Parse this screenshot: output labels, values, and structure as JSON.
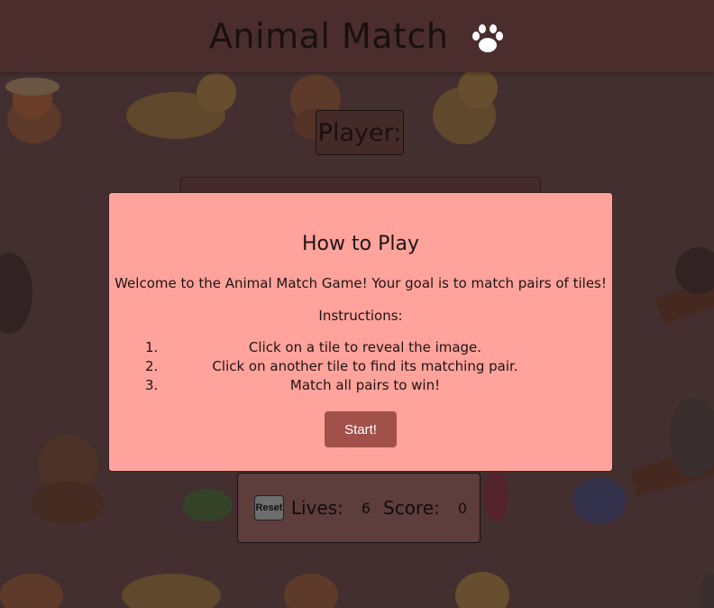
{
  "header": {
    "title": "Animal Match",
    "logo_icon": "paw-icon"
  },
  "player": {
    "label": "Player:"
  },
  "modal": {
    "title": "How to Play",
    "welcome": "Welcome to the Animal Match Game! Your goal is to match pairs of tiles!",
    "instructions_title": "Instructions:",
    "steps": [
      {
        "num": "1.",
        "text": "Click on a tile to reveal the image."
      },
      {
        "num": "2.",
        "text": "Click on another tile to find its matching pair."
      },
      {
        "num": "3.",
        "text": "Match all pairs to win!"
      }
    ],
    "start_label": "Start!"
  },
  "status": {
    "reset_label": "Reset",
    "lives_label": "Lives:",
    "lives_value": "6",
    "score_label": "Score:",
    "score_value": "0"
  },
  "colors": {
    "background": "#5a4545",
    "header": "#4c2d2d",
    "modal": "#ffa39c",
    "start_button": "#a2504a"
  }
}
